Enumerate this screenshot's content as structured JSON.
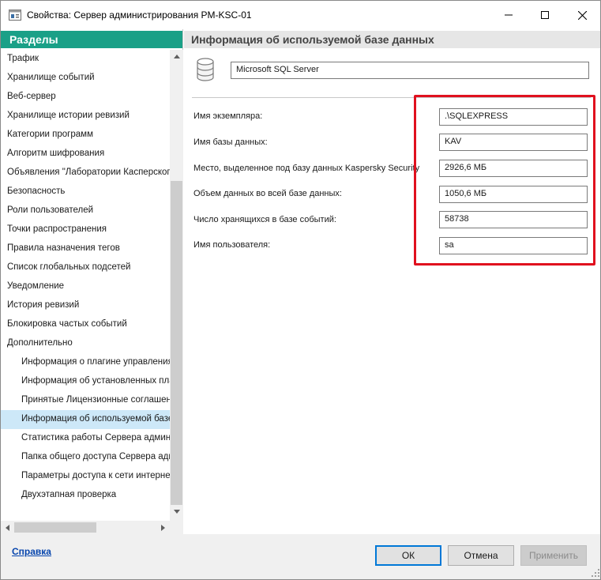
{
  "window": {
    "title": "Свойства: Сервер администрирования PM-KSC-01",
    "controls": {
      "minimize_icon": "minimize-icon",
      "maximize_icon": "maximize-icon",
      "close_icon": "close-icon"
    }
  },
  "sidebar": {
    "header": "Разделы",
    "items": [
      {
        "label": "Трафик"
      },
      {
        "label": "Хранилище событий"
      },
      {
        "label": "Веб-сервер"
      },
      {
        "label": "Хранилище истории ревизий"
      },
      {
        "label": "Категории программ"
      },
      {
        "label": "Алгоритм шифрования"
      },
      {
        "label": "Объявления \"Лаборатории Касперского\""
      },
      {
        "label": "Безопасность"
      },
      {
        "label": "Роли пользователей"
      },
      {
        "label": "Точки распространения"
      },
      {
        "label": "Правила назначения тегов"
      },
      {
        "label": "Список глобальных подсетей"
      },
      {
        "label": "Уведомление"
      },
      {
        "label": "История ревизий"
      },
      {
        "label": "Блокировка частых событий"
      },
      {
        "label": "Дополнительно"
      },
      {
        "label": "Информация о плагине управления С"
      },
      {
        "label": "Информация об установленных плаги"
      },
      {
        "label": "Принятые Лицензионные соглашения"
      },
      {
        "label": "Информация об используемой базе д"
      },
      {
        "label": "Статистика работы Сервера админи"
      },
      {
        "label": "Папка общего доступа Сервера адми"
      },
      {
        "label": "Параметры доступа к сети интернет"
      },
      {
        "label": "Двухэтапная проверка"
      }
    ],
    "selected_index": 19
  },
  "main": {
    "header": "Информация об используемой базе данных",
    "db_type": "Microsoft SQL Server",
    "fields": [
      {
        "label": "Имя экземпляра:",
        "value": ".\\SQLEXPRESS"
      },
      {
        "label": "Имя базы данных:",
        "value": "KAV"
      },
      {
        "label": "Место, выделенное под базу данных Kaspersky Security",
        "value": "2926,6 МБ"
      },
      {
        "label": "Объем данных во всей базе данных:",
        "value": "1050,6 МБ"
      },
      {
        "label": "Число хранящихся в базе событий:",
        "value": "58738"
      },
      {
        "label": "Имя пользователя:",
        "value": "sa"
      }
    ],
    "highlight_color": "#e0101e"
  },
  "footer": {
    "help": "Справка",
    "ok": "ОК",
    "cancel": "Отмена",
    "apply": "Применить"
  },
  "colors": {
    "accent": "#1aa087",
    "selection": "#cde8f8"
  }
}
